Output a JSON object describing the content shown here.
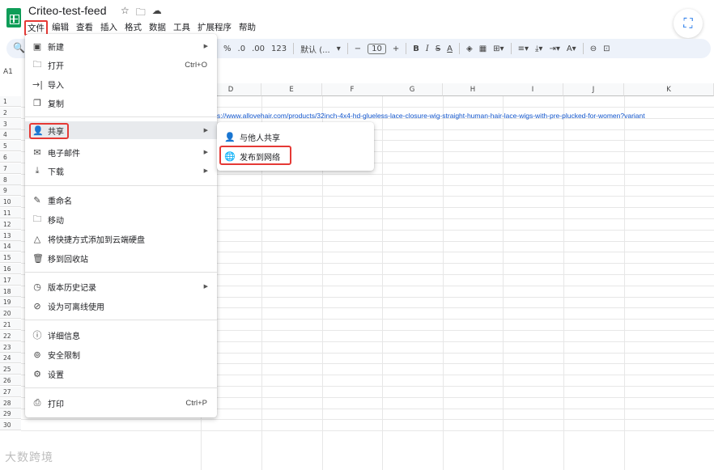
{
  "document": {
    "title": "Criteo-test-feed"
  },
  "title_icons": [
    "star-icon",
    "move-to-folder-icon",
    "cloud-status-icon"
  ],
  "menubar": [
    "文件",
    "编辑",
    "查看",
    "插入",
    "格式",
    "数据",
    "工具",
    "扩展程序",
    "帮助"
  ],
  "toolbar": {
    "percent": "%",
    "decimal_decrease": ".0",
    "decimal_increase": ".00",
    "number_format": "123",
    "font": "默认 (...",
    "font_size_minus": "−",
    "font_size": "10",
    "font_size_plus": "+",
    "bold": "B",
    "italic": "I",
    "strikethrough": "S",
    "text_color": "A"
  },
  "namebox": "A1",
  "columns": [
    "D",
    "E",
    "F",
    "G",
    "H",
    "I",
    "J",
    "K"
  ],
  "rows": [
    "1",
    "2",
    "3",
    "4",
    "5",
    "6",
    "7",
    "8",
    "9",
    "10",
    "11",
    "12",
    "13",
    "14",
    "15",
    "16",
    "17",
    "18",
    "19",
    "20",
    "21",
    "22",
    "23",
    "24",
    "25",
    "26",
    "27",
    "28",
    "29",
    "30"
  ],
  "cell_text": "s://www.allovehair.com/products/32inch-4x4-hd-glueless-lace-closure-wig-straight-human-hair-lace-wigs-with-pre-plucked-for-women?variant",
  "file_menu": {
    "new": "新建",
    "open": "打开",
    "open_shortcut": "Ctrl+O",
    "import": "导入",
    "copy": "复制",
    "share": "共享",
    "email": "电子邮件",
    "download": "下载",
    "rename": "重命名",
    "move": "移动",
    "add_shortcut": "将快捷方式添加到云端硬盘",
    "trash": "移到回收站",
    "version_history": "版本历史记录",
    "offline": "设为可离线使用",
    "details": "详细信息",
    "security": "安全限制",
    "settings": "设置",
    "print": "打印",
    "print_shortcut": "Ctrl+P"
  },
  "share_menu": {
    "share_with_others": "与他人共享",
    "publish_to_web": "发布到网络"
  },
  "watermark": "大数跨境",
  "colors": {
    "highlight_box": "#e53935",
    "link": "#1155cc",
    "sheets_green": "#0f9d58",
    "toolbar_bg": "#edf2fa"
  }
}
